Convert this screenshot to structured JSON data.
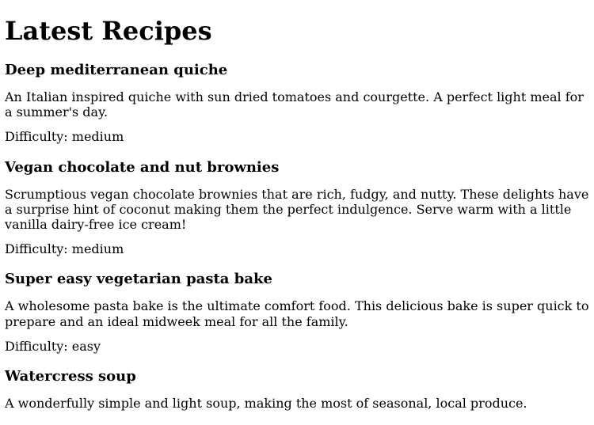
{
  "page_title": "Latest Recipes",
  "difficulty_label": "Difficulty: ",
  "recipes": [
    {
      "name": "Deep mediterranean quiche",
      "description": "An Italian inspired quiche with sun dried tomatoes and courgette. A perfect light meal for a summer's day.",
      "difficulty": "medium"
    },
    {
      "name": "Vegan chocolate and nut brownies",
      "description": "Scrumptious vegan chocolate brownies that are rich, fudgy, and nutty. These delights have a surprise hint of coconut making them the perfect indulgence. Serve warm with a little vanilla dairy-free ice cream!",
      "difficulty": "medium"
    },
    {
      "name": "Super easy vegetarian pasta bake",
      "description": "A wholesome pasta bake is the ultimate comfort food. This delicious bake is super quick to prepare and an ideal midweek meal for all the family.",
      "difficulty": "easy"
    },
    {
      "name": "Watercress soup",
      "description": "A wonderfully simple and light soup, making the most of seasonal, local produce.",
      "difficulty": null
    }
  ]
}
